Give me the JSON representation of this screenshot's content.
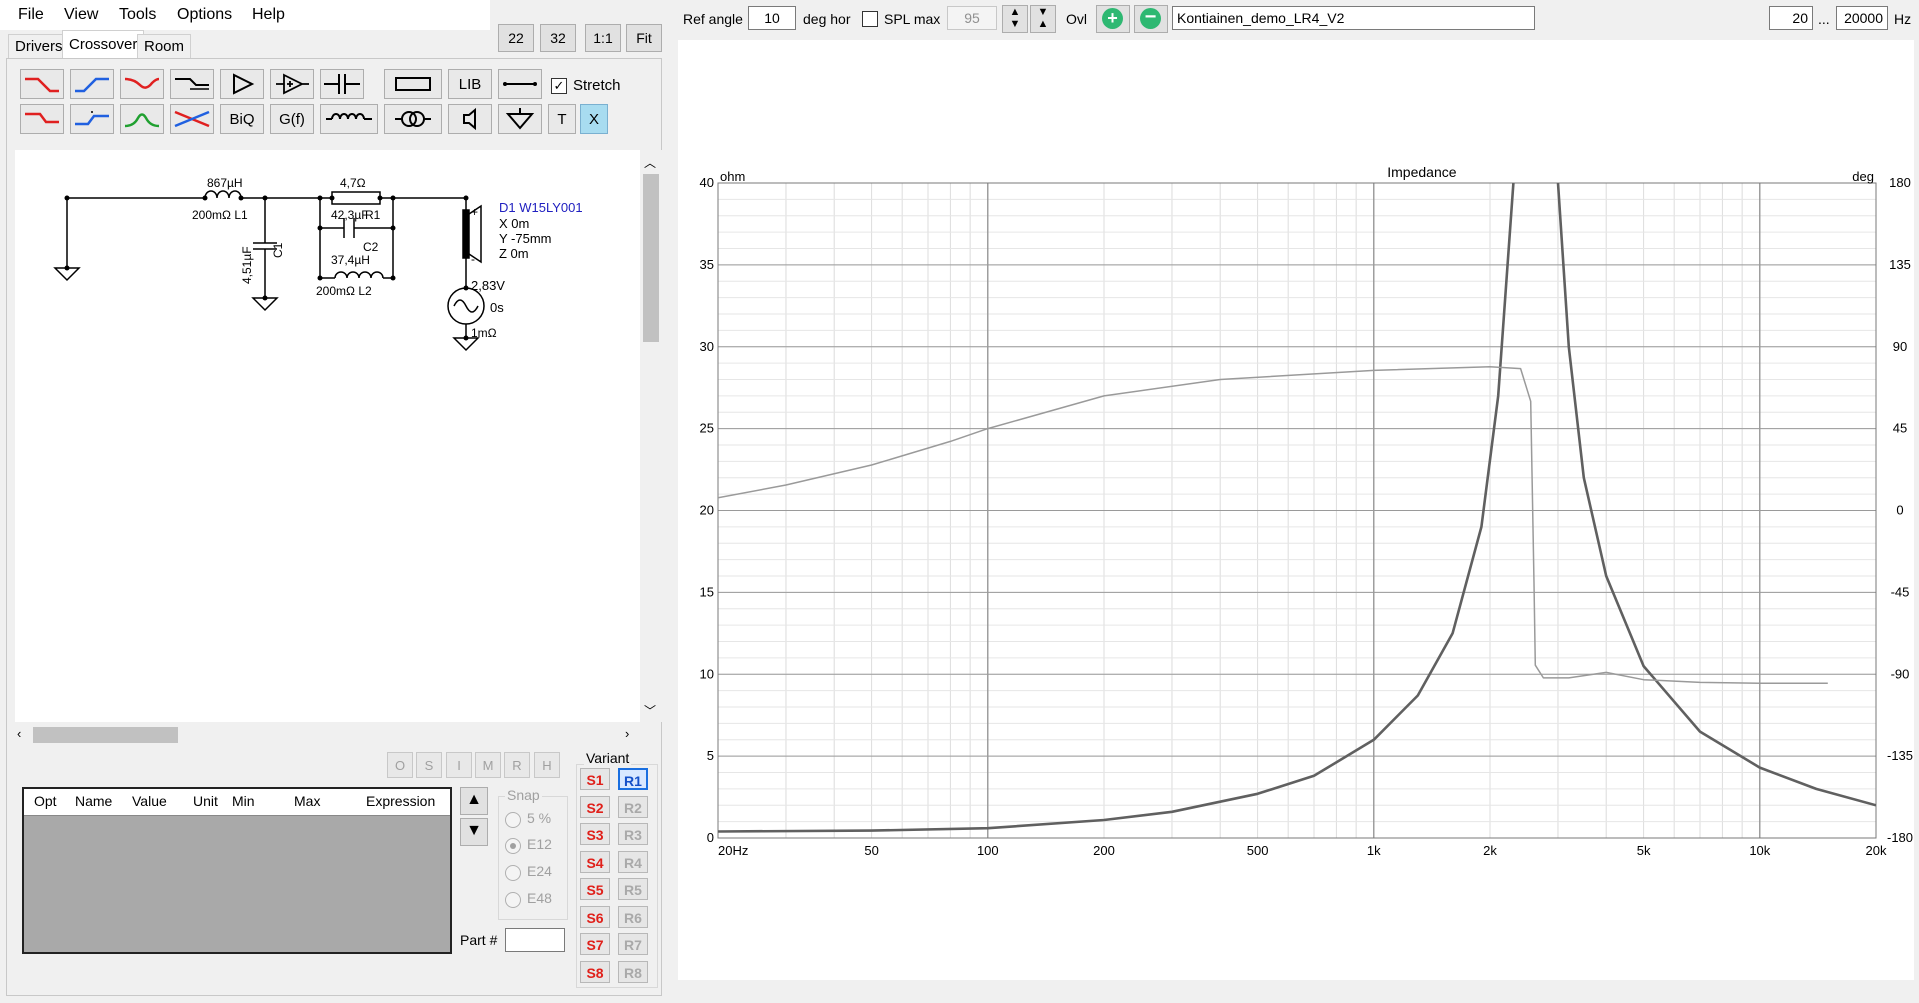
{
  "menu": [
    "File",
    "View",
    "Tools",
    "Options",
    "Help"
  ],
  "tabs": [
    "Drivers",
    "Crossover",
    "Room"
  ],
  "zoom_buttons": [
    "22",
    "32",
    "1:1",
    "Fit"
  ],
  "toolbar": {
    "lib_label": "LIB",
    "stretch_label": "Stretch",
    "stretch_checked": true,
    "biq_label": "BiQ",
    "gf_label": "G(f)",
    "t_label": "T",
    "x_label": "X"
  },
  "schematic": {
    "l1_value": "867µH",
    "l1_label": "200mΩ L1",
    "c1_value": "4,51µF",
    "c1_label": "C1",
    "r1_value": "4,7Ω",
    "r1_label": "R1",
    "c2_value": "42,3µF",
    "c2_label": "C2",
    "l2_value": "37,4µH",
    "l2_label": "200mΩ L2",
    "driver_name": "D1 W15LY001",
    "driver_x": "X 0m",
    "driver_y": "Y -75mm",
    "driver_z": "Z 0m",
    "source_voltage": "2,83V",
    "source_delay": "0s",
    "source_resistance": "1mΩ",
    "plus": "+",
    "minus": "-"
  },
  "opt_buttons": [
    "O",
    "S",
    "I",
    "M",
    "R",
    "H"
  ],
  "parts_table": {
    "columns": [
      "Opt",
      "Name",
      "Value",
      "Unit",
      "Min",
      "Max",
      "Expression"
    ]
  },
  "snap": {
    "label": "Snap",
    "options": [
      "5 %",
      "E12",
      "E24",
      "E48"
    ],
    "selected": "E12"
  },
  "part_number_label": "Part #",
  "variant": {
    "label": "Variant",
    "s_buttons": [
      "S1",
      "S2",
      "S3",
      "S4",
      "S5",
      "S6",
      "S7",
      "S8"
    ],
    "r_buttons": [
      "R1",
      "R2",
      "R3",
      "R4",
      "R5",
      "R6",
      "R7",
      "R8"
    ],
    "active_r": "R1"
  },
  "top": {
    "ref_angle_label": "Ref angle",
    "ref_angle_value": "10",
    "deg_hor_label": "deg hor",
    "spl_max_label": "SPL max",
    "spl_max_value": "95",
    "ovl_label": "Ovl",
    "project_name": "Kontiainen_demo_LR4_V2",
    "freq_min": "20",
    "freq_sep": "...",
    "freq_max": "20000",
    "hz_label": "Hz"
  },
  "chart_data": {
    "type": "line",
    "title": "Impedance",
    "y_left_unit": "ohm",
    "y_right_unit": "deg",
    "x_scale": "log",
    "xlim": [
      20,
      20000
    ],
    "ylim_left": [
      0,
      40
    ],
    "ylim_right": [
      -180,
      180
    ],
    "x_ticks": [
      {
        "v": 20,
        "label": "20Hz"
      },
      {
        "v": 50,
        "label": "50"
      },
      {
        "v": 100,
        "label": "100"
      },
      {
        "v": 200,
        "label": "200"
      },
      {
        "v": 500,
        "label": "500"
      },
      {
        "v": 1000,
        "label": "1k"
      },
      {
        "v": 2000,
        "label": "2k"
      },
      {
        "v": 5000,
        "label": "5k"
      },
      {
        "v": 10000,
        "label": "10k"
      },
      {
        "v": 20000,
        "label": "20k"
      }
    ],
    "y_left_ticks": [
      "0",
      "5",
      "10",
      "15",
      "20",
      "25",
      "30",
      "35",
      "40"
    ],
    "y_right_ticks": [
      "-180",
      "-135",
      "-90",
      "-45",
      "0",
      "45",
      "90",
      "135",
      "180"
    ],
    "grid": true,
    "series": [
      {
        "axis": "left",
        "color": "#606060",
        "points": [
          [
            20,
            0.4
          ],
          [
            50,
            0.45
          ],
          [
            100,
            0.6
          ],
          [
            200,
            1.1
          ],
          [
            300,
            1.6
          ],
          [
            500,
            2.7
          ],
          [
            700,
            3.8
          ],
          [
            1000,
            6.0
          ],
          [
            1300,
            8.7
          ],
          [
            1600,
            12.5
          ],
          [
            1900,
            19
          ],
          [
            2100,
            27
          ],
          [
            2300,
            40
          ]
        ]
      },
      {
        "axis": "left",
        "color": "#606060",
        "points": [
          [
            3000,
            40
          ],
          [
            3200,
            30
          ],
          [
            3500,
            22
          ],
          [
            4000,
            16
          ],
          [
            5000,
            10.5
          ],
          [
            7000,
            6.5
          ],
          [
            10000,
            4.3
          ],
          [
            14000,
            3.0
          ],
          [
            20000,
            2.0
          ]
        ]
      },
      {
        "axis": "right",
        "color": "#9a9a9a",
        "points": [
          [
            20,
            7
          ],
          [
            30,
            14
          ],
          [
            50,
            25
          ],
          [
            80,
            38
          ],
          [
            100,
            45
          ],
          [
            200,
            63
          ],
          [
            400,
            72
          ],
          [
            1000,
            77
          ],
          [
            2000,
            79
          ],
          [
            2400,
            78
          ],
          [
            2550,
            60
          ],
          [
            2600,
            -40
          ],
          [
            2620,
            -85
          ],
          [
            2750,
            -92
          ],
          [
            3200,
            -92
          ],
          [
            4000,
            -89
          ],
          [
            5000,
            -93
          ],
          [
            7000,
            -94.5
          ],
          [
            10000,
            -95
          ],
          [
            15000,
            -95
          ]
        ]
      }
    ]
  }
}
